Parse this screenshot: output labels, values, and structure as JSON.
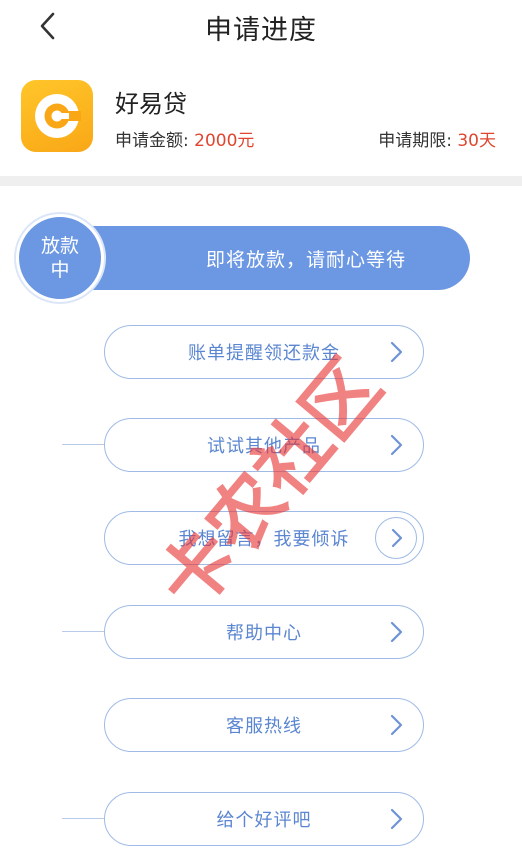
{
  "header": {
    "title": "申请进度"
  },
  "product": {
    "name": "好易贷",
    "amount_label": "申请金额: ",
    "amount_value": "2000元",
    "term_label": "申请期限: ",
    "term_value": "30天",
    "logo_icon": "c-coin-logo-icon"
  },
  "status": {
    "badge": "放款中",
    "message": "即将放款，请耐心等待"
  },
  "actions": [
    {
      "label": "账单提醒领还款金"
    },
    {
      "label": "试试其他产品"
    },
    {
      "label": "我想留言，我要倾诉"
    },
    {
      "label": "帮助中心"
    },
    {
      "label": "客服热线"
    },
    {
      "label": "给个好评吧"
    }
  ],
  "watermark": "卡农社区",
  "colors": {
    "accent_blue": "#6b97e3",
    "link_blue": "#5b86d1",
    "value_red": "#e0452f",
    "logo_orange": "#f9a716"
  }
}
